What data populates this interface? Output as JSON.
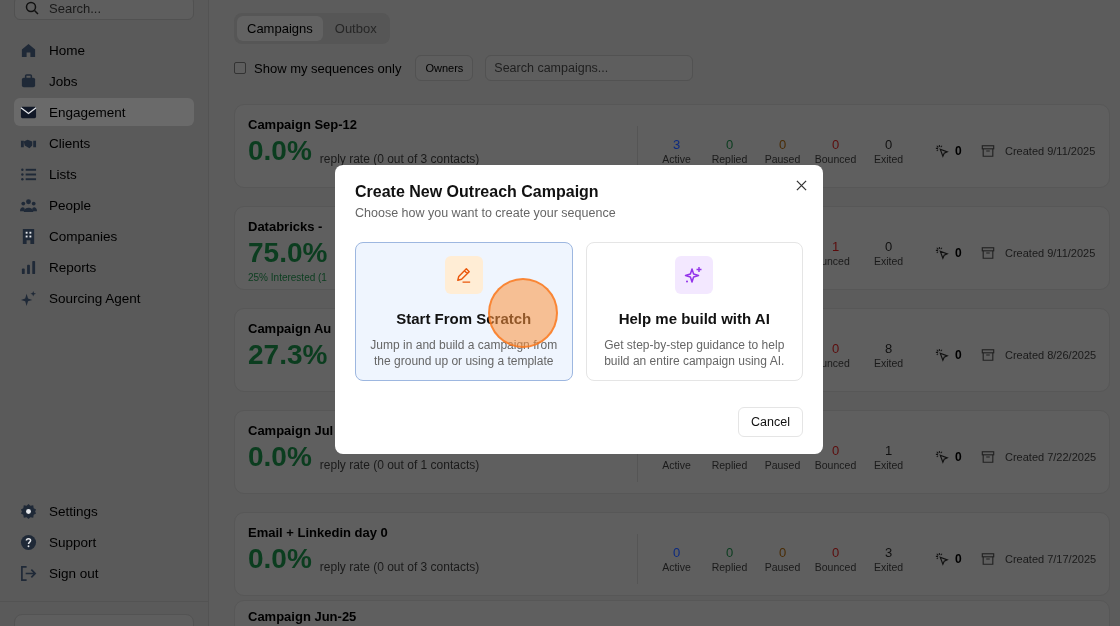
{
  "sidebar": {
    "search": {
      "placeholder": "Search..."
    },
    "items": [
      {
        "label": "Home",
        "selected": false
      },
      {
        "label": "Jobs",
        "selected": false
      },
      {
        "label": "Engagement",
        "selected": true
      },
      {
        "label": "Clients",
        "selected": false
      },
      {
        "label": "Lists",
        "selected": false
      },
      {
        "label": "People",
        "selected": false
      },
      {
        "label": "Companies",
        "selected": false
      },
      {
        "label": "Reports",
        "selected": false
      },
      {
        "label": "Sourcing Agent",
        "selected": false
      }
    ],
    "footer_items": [
      {
        "label": "Settings"
      },
      {
        "label": "Support"
      },
      {
        "label": "Sign out"
      }
    ]
  },
  "tabs": [
    {
      "label": "Campaigns",
      "selected": true
    },
    {
      "label": "Outbox",
      "selected": false
    }
  ],
  "filters": {
    "my_sequences": {
      "label": "Show my sequences only",
      "checked": false
    },
    "owners": "Owners",
    "search": {
      "placeholder": "Search campaigns..."
    }
  },
  "campaigns": [
    {
      "title": "Campaign Sep-12",
      "rate": "0.0%",
      "detail": "reply rate (0 out of 3 contacts)",
      "stats": [
        {
          "value": "3",
          "label": "Active",
          "color": "#0c2a80"
        },
        {
          "value": "0",
          "label": "Replied",
          "color": "#0b3d1f"
        },
        {
          "value": "0",
          "label": "Paused",
          "color": "#4a2c05"
        },
        {
          "value": "0",
          "label": "Bounced",
          "color": "#5c0c0c"
        },
        {
          "value": "0",
          "label": "Exited",
          "color": "#111111"
        }
      ],
      "clicks": "0",
      "created": "Created 9/11/2025"
    },
    {
      "title": "Databricks -",
      "rate": "75.0%",
      "note": "25% Interested (1",
      "stats": [
        {
          "value": "1",
          "label": "unced",
          "color": "#5c0c0c"
        },
        {
          "value": "0",
          "label": "Exited",
          "color": "#111111"
        }
      ],
      "clicks": "0",
      "created": "Created 9/11/2025"
    },
    {
      "title": "Campaign Au",
      "rate": "27.3%",
      "stats": [
        {
          "value": "0",
          "label": "unced",
          "color": "#5c0c0c"
        },
        {
          "value": "8",
          "label": "Exited",
          "color": "#111111"
        }
      ],
      "clicks": "0",
      "created": "Created 8/26/2025"
    },
    {
      "title": "Campaign Jul",
      "rate": "0.0%",
      "detail": "reply rate (0 out of 1 contacts)",
      "stats": [
        {
          "label": "Active"
        },
        {
          "label": "Replied"
        },
        {
          "label": "Paused"
        },
        {
          "value": "0",
          "label": "Bounced",
          "color": "#5c0c0c"
        },
        {
          "value": "1",
          "label": "Exited",
          "color": "#111111"
        }
      ],
      "clicks": "0",
      "created": "Created 7/22/2025"
    },
    {
      "title": "Email + Linkedin day 0",
      "rate": "0.0%",
      "detail": "reply rate (0 out of 3 contacts)",
      "stats": [
        {
          "value": "0",
          "label": "Active",
          "color": "#0c2a80"
        },
        {
          "value": "0",
          "label": "Replied",
          "color": "#0b3d1f"
        },
        {
          "value": "0",
          "label": "Paused",
          "color": "#4a2c05"
        },
        {
          "value": "0",
          "label": "Bounced",
          "color": "#5c0c0c"
        },
        {
          "value": "3",
          "label": "Exited",
          "color": "#111111"
        }
      ],
      "clicks": "0",
      "created": "Created 7/17/2025"
    },
    {
      "title": "Campaign Jun-25"
    }
  ],
  "modal": {
    "title": "Create New Outreach Campaign",
    "subtitle": "Choose how you want to create your sequence",
    "options": [
      {
        "kind": "scratch",
        "title": "Start From Scratch",
        "description": "Jump in and build a campaign from the ground up or using a template",
        "selected": true
      },
      {
        "kind": "ai",
        "title": "Help me build with AI",
        "description": "Get step-by-step guidance to help build an entire campaign using AI.",
        "selected": false
      }
    ],
    "cancel": "Cancel"
  }
}
